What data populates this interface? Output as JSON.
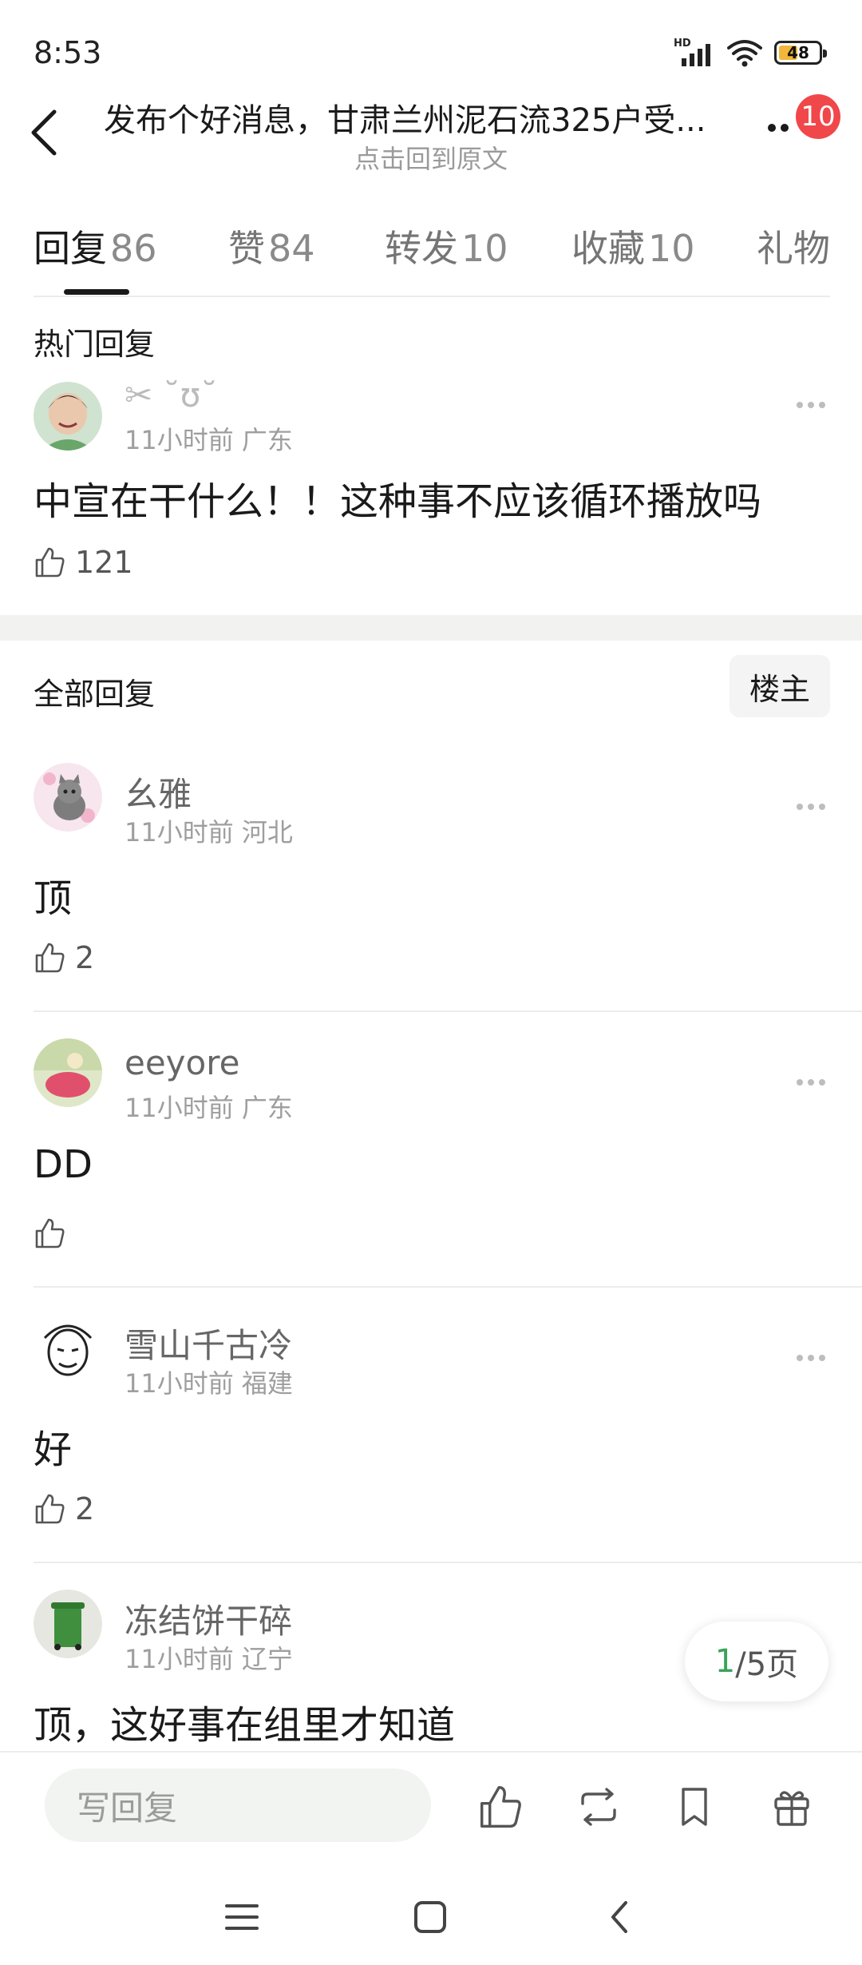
{
  "status_bar": {
    "time": "8:53",
    "network_label": "HD",
    "battery": "48",
    "battery_level": 0.48
  },
  "header": {
    "title": "发布个好消息，甘肃兰州泥石流325户受...",
    "subtitle": "点击回到原文",
    "badge_count": "10"
  },
  "tabs": [
    {
      "label": "回复",
      "count": "86"
    },
    {
      "label": "赞",
      "count": "84"
    },
    {
      "label": "转发",
      "count": "10"
    },
    {
      "label": "收藏",
      "count": "10"
    },
    {
      "label": "礼物",
      "count": ""
    }
  ],
  "hot_section": {
    "title": "热门回复",
    "comment": {
      "username": "✂ ˘ʊ˘",
      "time": "11小时前",
      "location": "广东",
      "text": "中宣在干什么！！这种事不应该循环播放吗",
      "likes": "121"
    }
  },
  "all_section": {
    "title": "全部回复",
    "owner_button": "楼主",
    "comments": [
      {
        "username": "幺雅",
        "time": "11小时前",
        "location": "河北",
        "text": "顶",
        "likes": "2"
      },
      {
        "username": "eeyore",
        "time": "11小时前",
        "location": "广东",
        "text": "DD",
        "likes": ""
      },
      {
        "username": "雪山千古冷",
        "time": "11小时前",
        "location": "福建",
        "text": "好",
        "likes": "2"
      },
      {
        "username": "冻结饼干碎",
        "time": "11小时前",
        "location": "辽宁",
        "text": "顶，这好事在组里才知道",
        "likes": ""
      }
    ]
  },
  "pager": {
    "current": "1",
    "total_text": "/5页"
  },
  "bottom_bar": {
    "reply_placeholder": "写回复"
  },
  "colors": {
    "accent_green": "#3aa35a",
    "badge_red": "#f0474a"
  }
}
